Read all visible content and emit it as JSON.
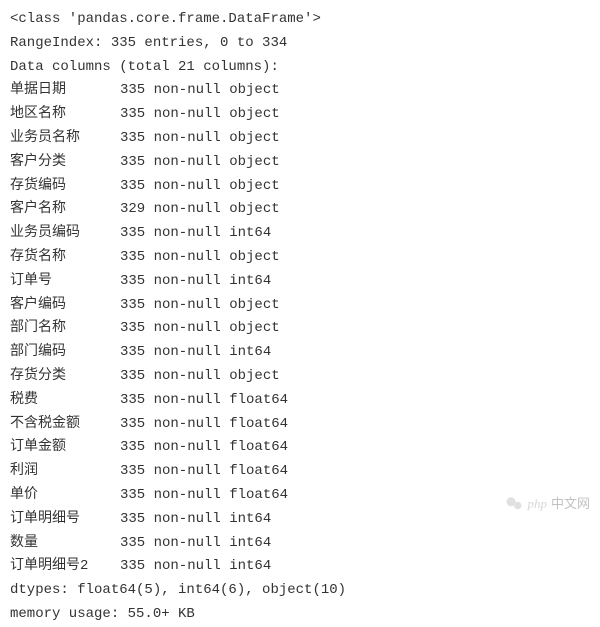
{
  "header": {
    "class_line": "<class 'pandas.core.frame.DataFrame'>",
    "range_index": "RangeIndex: 335 entries, 0 to 334",
    "columns_intro": "Data columns (total 21 columns):"
  },
  "columns": [
    {
      "name": "单据日期",
      "info": "335 non-null object"
    },
    {
      "name": "地区名称",
      "info": "335 non-null object"
    },
    {
      "name": "业务员名称",
      "info": "335 non-null object"
    },
    {
      "name": "客户分类",
      "info": "335 non-null object"
    },
    {
      "name": "存货编码",
      "info": "335 non-null object"
    },
    {
      "name": "客户名称",
      "info": "329 non-null object"
    },
    {
      "name": "业务员编码",
      "info": "335 non-null int64"
    },
    {
      "name": "存货名称",
      "info": "335 non-null object"
    },
    {
      "name": "订单号",
      "info": "335 non-null int64"
    },
    {
      "name": "客户编码",
      "info": "335 non-null object"
    },
    {
      "name": "部门名称",
      "info": "335 non-null object"
    },
    {
      "name": "部门编码",
      "info": "335 non-null int64"
    },
    {
      "name": "存货分类",
      "info": "335 non-null object"
    },
    {
      "name": "税费",
      "info": "335 non-null float64"
    },
    {
      "name": "不含税金额",
      "info": "335 non-null float64"
    },
    {
      "name": "订单金额",
      "info": "335 non-null float64"
    },
    {
      "name": "利润",
      "info": "335 non-null float64"
    },
    {
      "name": "单价",
      "info": "335 non-null float64"
    },
    {
      "name": "订单明细号",
      "info": "335 non-null int64"
    },
    {
      "name": "数量",
      "info": "335 non-null int64"
    },
    {
      "name": "订单明细号2",
      "info": "335 non-null int64"
    }
  ],
  "footer": {
    "dtypes": "dtypes: float64(5), int64(6), object(10)",
    "memory": "memory usage: 55.0+ KB"
  },
  "watermark": {
    "logo": "php",
    "text": "中文网"
  }
}
